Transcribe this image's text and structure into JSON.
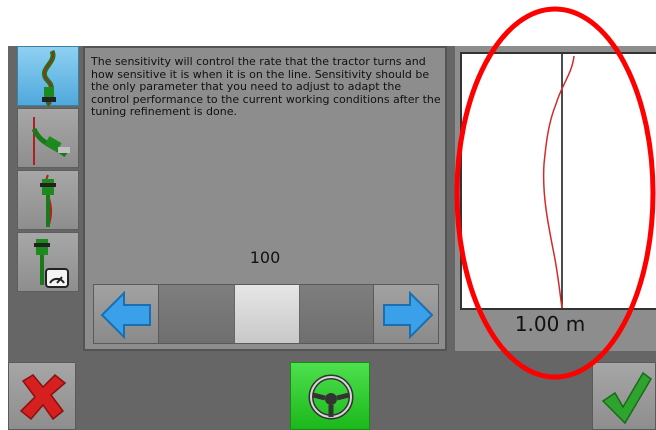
{
  "sidebar": {
    "items": [
      {
        "name": "sensitivity",
        "icon": "tractor-curve-path-icon",
        "active": true
      },
      {
        "name": "approach",
        "icon": "tractor-approach-line-icon",
        "active": false
      },
      {
        "name": "on-line",
        "icon": "tractor-on-line-icon",
        "active": false
      },
      {
        "name": "speed",
        "icon": "tractor-speedometer-icon",
        "active": false
      }
    ]
  },
  "panel": {
    "description": "The sensitivity will control the rate that the tractor turns and how sensitive it is when it is on the line. Sensitivity should be the only parameter that you need to adjust to adapt the control performance to the current working conditions after the tuning refinement is done.",
    "value": "100",
    "slider_level": 0.5
  },
  "plot": {
    "scale_label": "1.00 m"
  },
  "buttons": {
    "cancel_icon": "red-x-icon",
    "steer_icon": "steering-wheel-icon",
    "confirm_icon": "green-check-icon"
  },
  "colors": {
    "active_tab": "#4fa9dc",
    "steer_button": "#1bb81b",
    "track_line": "#d42a2a",
    "annotation": "#ff0000"
  }
}
